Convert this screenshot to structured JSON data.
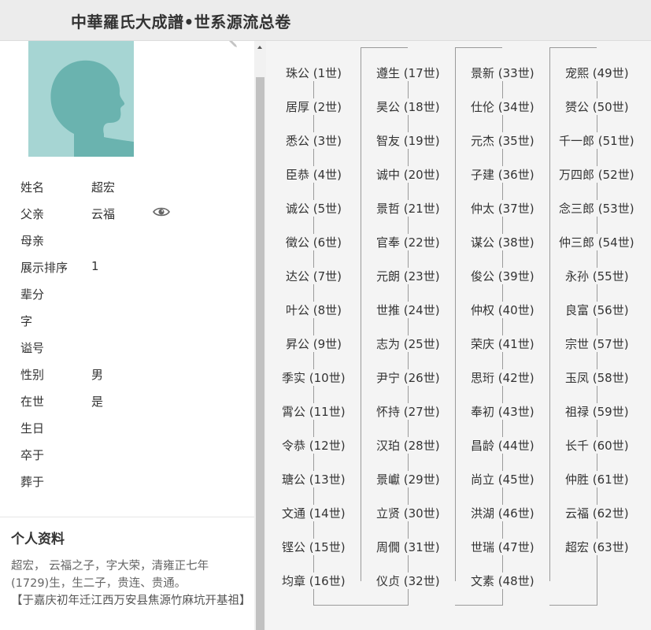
{
  "header": {
    "title": "中華羅氏大成譜•世系源流总卷"
  },
  "person": {
    "fields": [
      {
        "label": "姓名",
        "value": "超宏"
      },
      {
        "label": "父亲",
        "value": "云福"
      },
      {
        "label": "母亲",
        "value": ""
      },
      {
        "label": "展示排序",
        "value": "1"
      },
      {
        "label": "辈分",
        "value": ""
      },
      {
        "label": "字",
        "value": ""
      },
      {
        "label": "谥号",
        "value": ""
      },
      {
        "label": "性别",
        "value": "男"
      },
      {
        "label": "在世",
        "value": "是"
      },
      {
        "label": "生日",
        "value": ""
      },
      {
        "label": "卒于",
        "value": ""
      },
      {
        "label": "葬于",
        "value": ""
      }
    ]
  },
  "profile": {
    "title": "个人资料",
    "line1": "超宏， 云福之子，字大荣，清雍正七年(1729)生，生二子，贵连、贵通。",
    "line2": "【于嘉庆初年迁江西万安县焦源竹麻坑开基祖】"
  },
  "icons": {
    "avatar": "person-silhouette-icon",
    "eye": "eye-icon",
    "edit": "pencil-icon"
  },
  "colors": {
    "avatar_bg": "#a6d5d3",
    "avatar_figure": "#6ab3af",
    "tree_line": "#9a9a9a"
  },
  "generations": [
    [
      "珠公 (1世)",
      "居厚 (2世)",
      "悉公 (3世)",
      "臣恭 (4世)",
      "诚公 (5世)",
      "徵公 (6世)",
      "达公 (7世)",
      "叶公 (8世)",
      "昇公 (9世)",
      "季实 (10世)",
      "霄公 (11世)",
      "令恭 (12世)",
      "瑭公 (13世)",
      "文通 (14世)",
      "铿公 (15世)",
      "均章 (16世)"
    ],
    [
      "遵生 (17世)",
      "昊公 (18世)",
      "智友 (19世)",
      "诚中 (20世)",
      "景哲 (21世)",
      "官奉 (22世)",
      "元朗 (23世)",
      "世推 (24世)",
      "志为 (25世)",
      "尹宁 (26世)",
      "怀持 (27世)",
      "汉珀 (28世)",
      "景巘 (29世)",
      "立贤 (30世)",
      "周僩 (31世)",
      "仪贞 (32世)"
    ],
    [
      "景新 (33世)",
      "仕伦 (34世)",
      "元杰 (35世)",
      "子建 (36世)",
      "仲太 (37世)",
      "谋公 (38世)",
      "俊公 (39世)",
      "仲权 (40世)",
      "荣庆 (41世)",
      "思珩 (42世)",
      "奉初 (43世)",
      "昌龄 (44世)",
      "尚立 (45世)",
      "洪湖 (46世)",
      "世瑞 (47世)",
      "文素 (48世)"
    ],
    [
      "宠熙 (49世)",
      "赟公 (50世)",
      "千一郎 (51世)",
      "万四郎 (52世)",
      "念三郎 (53世)",
      "仲三郎 (54世)",
      "永孙 (55世)",
      "良富 (56世)",
      "宗世 (57世)",
      "玉凤 (58世)",
      "祖禄 (59世)",
      "长千 (60世)",
      "仲胜 (61世)",
      "云福 (62世)",
      "超宏 (63世)"
    ]
  ]
}
